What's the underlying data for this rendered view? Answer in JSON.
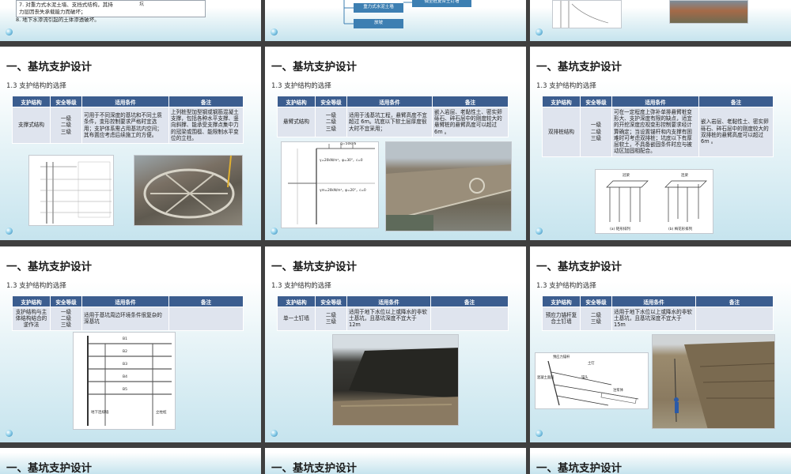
{
  "section_title": "一、基坑支护设计",
  "subsection": "1.3 支护结构的选择",
  "table_headers": [
    "支护结构",
    "安全等级",
    "适用条件",
    "备注"
  ],
  "top_row": {
    "left_lines": [
      "7. 对重力式水泥土墙、支挡式结构，其持",
      "力层因丧失承载能力而破坏；",
      "8. 地下水渗流引起的土体渗透破坏。"
    ],
    "left_side_note": "坑",
    "mid_boxes": [
      "重力式水泥土墙",
      "放坡",
      "微型桩复合土钉墙"
    ]
  },
  "slides": [
    {
      "name": "support-strut",
      "structure": "支撑式结构",
      "levels": "一级\n二级\n三级",
      "condition": "可用于不同深度的基坑和不同土质条件，变形控制要求严格时宜选用；支护体系需占用基坑内空间；其布置应考虑后续施工的方便。",
      "remark": "上列桩型加型钢或钢筋混凝土支撑，包括各种水平支撑、竖向斜撑、能承受支撑点集中力的冠梁或围檩、能限制水平变位的立柱。"
    },
    {
      "name": "support-cantilever",
      "structure": "悬臂式结构",
      "levels": "一级\n二级\n三级",
      "condition": "适用于浅基坑工程，悬臂高度不宜超过 6m。坑底以下软土层厚度很大时不宜采用；",
      "remark": "嵌入岩层、老黏性土、密实卵砾石、碎石层中的刚度较大的悬臂桩的悬臂高度可以超过 6m 。",
      "diagram_labels": [
        "q=50kPa",
        "γ=20kN/m³，φ=30°，c=0",
        "γm=20kN/m³，φ=20°，c=0"
      ]
    },
    {
      "name": "support-double-row-pile",
      "structure": "双排桩结构",
      "levels": "一级\n二级\n三级",
      "condition": "可在一定程度上弥补单排悬臂桩变形大、支护深度有限的缺点，适宜的开挖深度应视变形控制要求经计算确定；当设置锚杆和内支撑有困难时可考虑双排桩；坑底以下有厚层软土，不具备嵌固条件时应与被动区加固相配合。",
      "remark": "嵌入岩层、老黏性土、密实卵砾石、碎石层中的刚度较大的双排桩的悬臂高度可以超过 6m 。",
      "diagram_captions": [
        "(a) 矩形排列",
        "(b) 梅花形排列"
      ],
      "diagram_labels": [
        "冠梁",
        "连梁"
      ]
    },
    {
      "name": "support-combined",
      "structure": "支护结构与主体结构结合的逆作法",
      "levels": "一级\n二级\n三级",
      "condition": "适用于基坑周边环境条件很复杂的深基坑",
      "remark": "",
      "diagram_labels": [
        "地下连续墙",
        "立柱桩",
        "B1",
        "B2",
        "B3",
        "B4",
        "B5"
      ]
    },
    {
      "name": "support-soil-nail",
      "structure": "单一土钉墙",
      "levels": "二级\n三级",
      "condition": "适用于地下水位以上或降水的非软土基坑，且基坑深度不宜大于 12m",
      "remark": ""
    },
    {
      "name": "support-prestressed-anchor",
      "structure": "预应力锚杆复合土钉墙",
      "levels": "二级\n三级",
      "condition": "适用于地下水位以上或降水的非软土基坑，且基坑深度不宜大于 15m",
      "remark": "",
      "diagram_labels": [
        "预应力锚杆",
        "土钉",
        "混凝土面层",
        "锚头",
        "注浆体"
      ]
    }
  ],
  "colors": {
    "header_blue": "#3b5d8f",
    "row_light": "#dfe4ee",
    "slide_gradient_bottom": "#c6e4ee",
    "background": "#3f3f3f"
  }
}
